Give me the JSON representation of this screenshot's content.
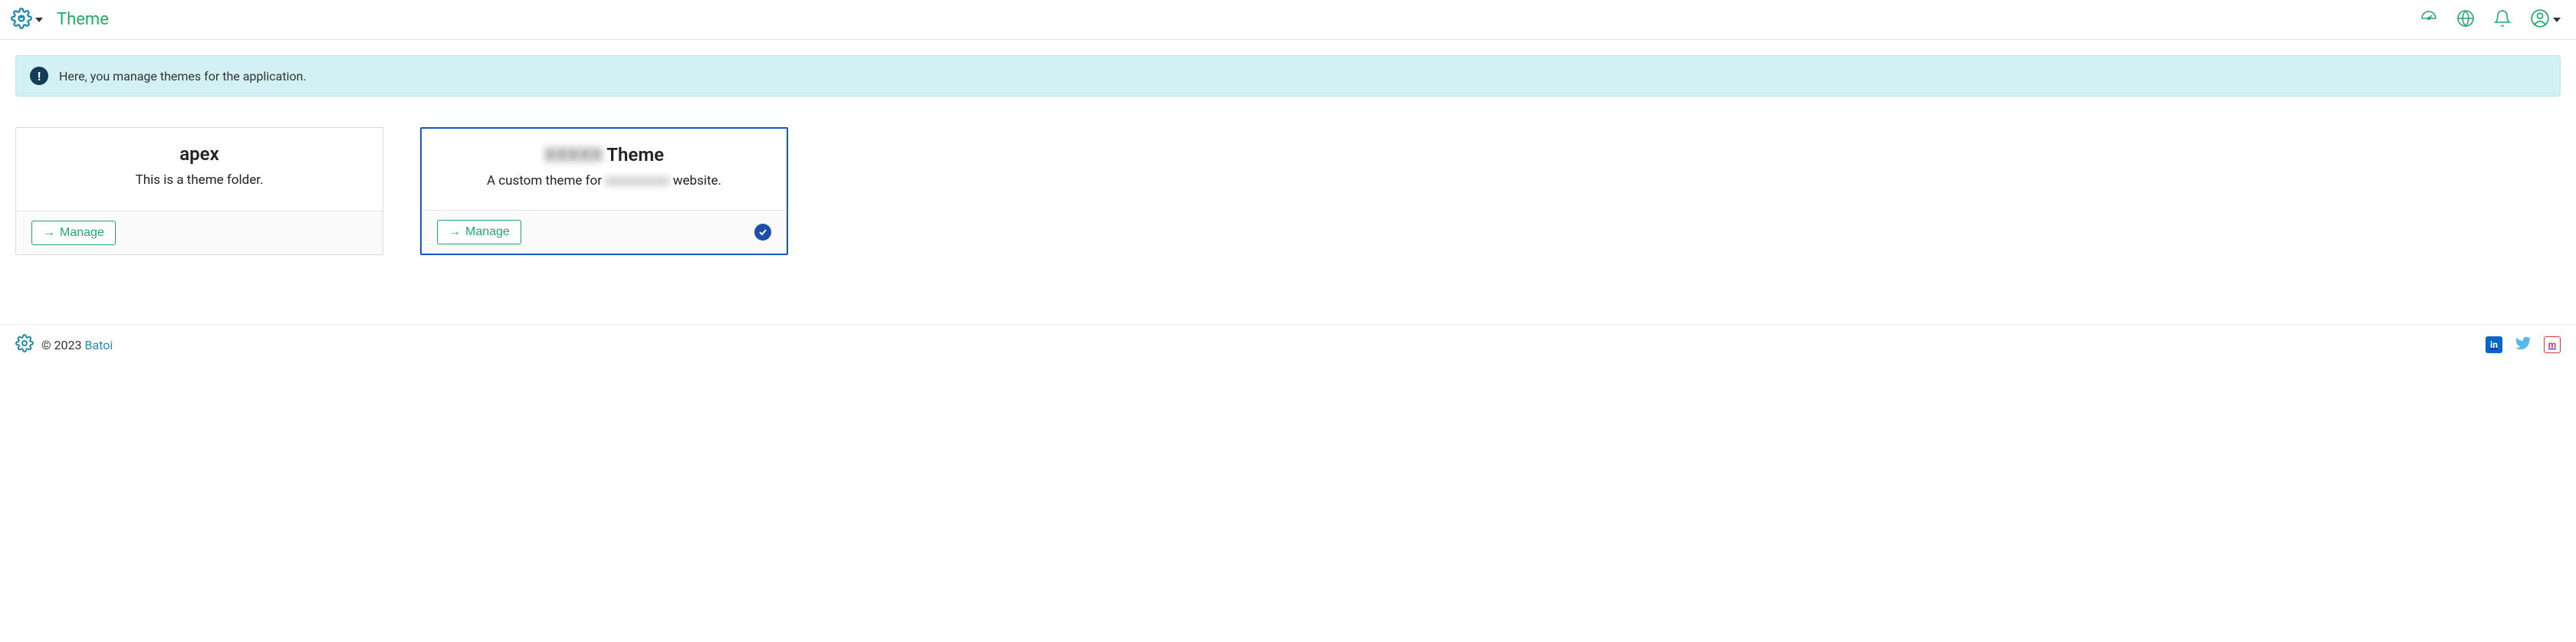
{
  "header": {
    "title": "Theme"
  },
  "banner": {
    "text": "Here, you manage themes for the application."
  },
  "themes": [
    {
      "title": "apex",
      "description": "This is a theme folder.",
      "manage_label": "Manage",
      "selected": false
    },
    {
      "title_prefix": "XXXXX",
      "title_suffix": " Theme",
      "desc_prefix": "A custom theme for ",
      "desc_mid": "xxxxxxxxxx",
      "desc_suffix": " website.",
      "manage_label": "Manage",
      "selected": true
    }
  ],
  "footer": {
    "copyright_prefix": "© 2023 ",
    "brand": "Batoi"
  }
}
